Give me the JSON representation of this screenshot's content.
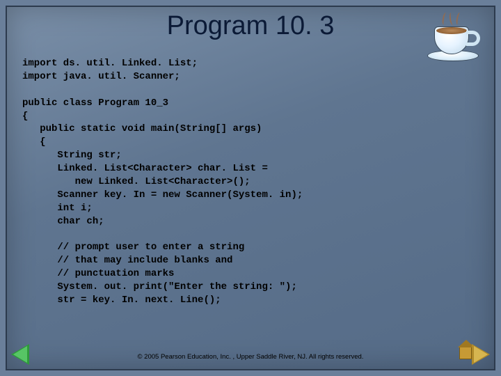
{
  "title": "Program 10. 3",
  "code_lines": [
    "import ds. util. Linked. List;",
    "import java. util. Scanner;",
    "",
    "public class Program 10_3",
    "{",
    "   public static void main(String[] args)",
    "   {",
    "      String str;",
    "      Linked. List<Character> char. List =",
    "         new Linked. List<Character>();",
    "      Scanner key. In = new Scanner(System. in);",
    "      int i;",
    "      char ch;",
    "",
    "      // prompt user to enter a string",
    "      // that may include blanks and",
    "      // punctuation marks",
    "      System. out. print(\"Enter the string: \");",
    "      str = key. In. next. Line();"
  ],
  "footer": "© 2005 Pearson Education, Inc. , Upper Saddle River, NJ.  All rights reserved.",
  "icons": {
    "coffee": "coffee-cup-icon",
    "prev": "prev-arrow-icon",
    "next": "next-home-icon"
  }
}
